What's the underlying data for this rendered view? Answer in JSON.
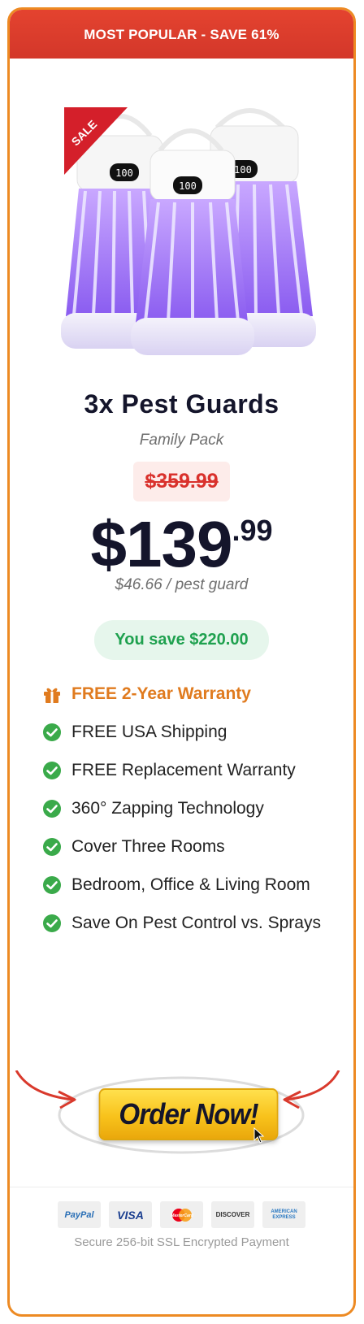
{
  "banner": {
    "text": "MOST POPULAR - SAVE 61%"
  },
  "product": {
    "badge": "SALE",
    "lamp_display": "100",
    "image_icon": "bug-zapper-lamps-image",
    "title": "3x Pest Guards",
    "subtitle": "Family Pack"
  },
  "pricing": {
    "original": "$359.99",
    "price_main": "$139",
    "price_cents": ".99",
    "per_unit": "$46.66 / pest guard",
    "savings": "You save $220.00"
  },
  "features": [
    {
      "label": "FREE 2-Year Warranty",
      "icon": "gift-icon"
    },
    {
      "label": "FREE USA Shipping",
      "icon": "check-circle-icon"
    },
    {
      "label": "FREE Replacement Warranty",
      "icon": "check-circle-icon"
    },
    {
      "label": "360° Zapping Technology",
      "icon": "check-circle-icon"
    },
    {
      "label": "Cover Three Rooms",
      "icon": "check-circle-icon"
    },
    {
      "label": "Bedroom, Office & Living Room",
      "icon": "check-circle-icon"
    },
    {
      "label": "Save On Pest Control vs. Sprays",
      "icon": "check-circle-icon"
    }
  ],
  "cta": {
    "label": "Order Now!"
  },
  "payment": {
    "methods": [
      "PayPal",
      "VISA",
      "MasterCard",
      "DISCOVER",
      "AMERICAN EXPRESS"
    ],
    "secure_text": "Secure 256-bit SSL Encrypted Payment"
  },
  "colors": {
    "border": "#ed8a23",
    "banner": "#d9392c",
    "accent_orange": "#e07b1f",
    "check_green": "#3aaa4a",
    "savings_green": "#1fa14f",
    "price_dark": "#14152b",
    "old_price_red": "#d9312c"
  }
}
